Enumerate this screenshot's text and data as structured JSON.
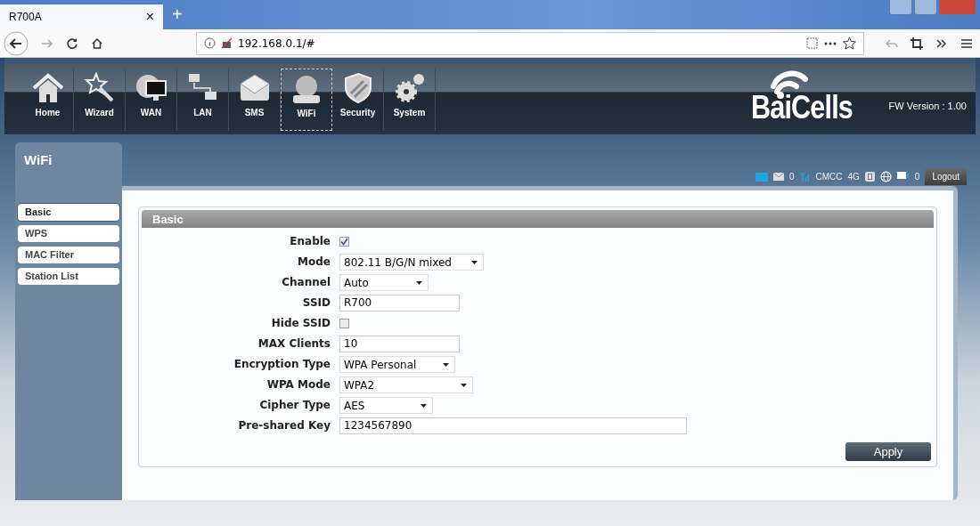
{
  "browser": {
    "tab_title": "R700A",
    "close": "×",
    "new_tab": "+",
    "url": "192.168.0.1/#"
  },
  "nav": [
    {
      "label": "Home",
      "selected": false
    },
    {
      "label": "Wizard",
      "selected": false
    },
    {
      "label": "WAN",
      "selected": false
    },
    {
      "label": "LAN",
      "selected": false
    },
    {
      "label": "SMS",
      "selected": false
    },
    {
      "label": "WiFi",
      "selected": true
    },
    {
      "label": "Security",
      "selected": false
    },
    {
      "label": "System",
      "selected": false
    }
  ],
  "logo": "BaiCells",
  "fw_version": "FW Version : 1.00",
  "page_title": "WiFi",
  "status": {
    "sms_count": "0",
    "operator": "CMCC",
    "network": "4G",
    "clients": "0",
    "logout": "Logout"
  },
  "sidebar": [
    {
      "label": "Basic",
      "selected": true
    },
    {
      "label": "WPS",
      "selected": false
    },
    {
      "label": "MAC Filter",
      "selected": false
    },
    {
      "label": "Station List",
      "selected": false
    }
  ],
  "section_title": "Basic",
  "fields": [
    {
      "label": "Enable",
      "kind": "checkbox",
      "checked": true
    },
    {
      "label": "Mode",
      "kind": "select",
      "value": "802.11 B/G/N mixed"
    },
    {
      "label": "Channel",
      "kind": "select",
      "value": "Auto"
    },
    {
      "label": "SSID",
      "kind": "text",
      "value": "R700"
    },
    {
      "label": "Hide SSID",
      "kind": "checkbox",
      "checked": false
    },
    {
      "label": "MAX Clients",
      "kind": "text",
      "value": "10"
    },
    {
      "label": "Encryption Type",
      "kind": "select",
      "value": "WPA Personal"
    },
    {
      "label": "WPA Mode",
      "kind": "select",
      "value": "WPA2"
    },
    {
      "label": "Cipher Type",
      "kind": "select",
      "value": "AES"
    },
    {
      "label": "Pre-shared Key",
      "kind": "text",
      "value": "1234567890"
    }
  ],
  "apply": "Apply"
}
